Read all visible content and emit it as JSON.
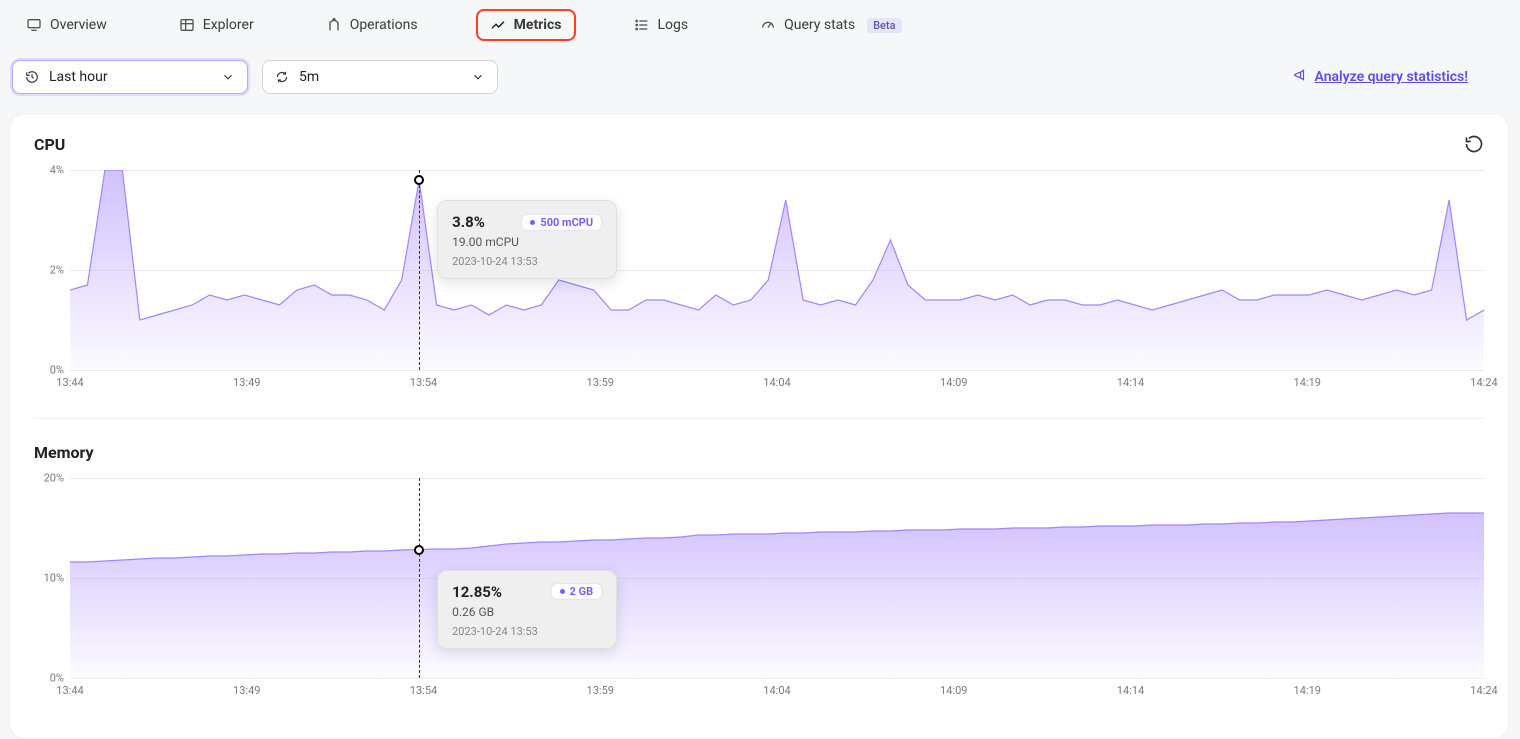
{
  "tabs": [
    {
      "key": "overview",
      "label": "Overview",
      "icon": "monitor-icon",
      "active": false
    },
    {
      "key": "explorer",
      "label": "Explorer",
      "icon": "table-icon",
      "active": false
    },
    {
      "key": "operations",
      "label": "Operations",
      "icon": "merge-icon",
      "active": false
    },
    {
      "key": "metrics",
      "label": "Metrics",
      "icon": "chart-icon",
      "active": true
    },
    {
      "key": "logs",
      "label": "Logs",
      "icon": "list-icon",
      "active": false
    },
    {
      "key": "querystats",
      "label": "Query stats",
      "icon": "gauge-icon",
      "active": false,
      "badge": "Beta"
    }
  ],
  "filters": {
    "range_label": "Last hour",
    "refresh_label": "5m"
  },
  "analyze_link": "Analyze query statistics!",
  "colors": {
    "accent": "#5b4ced",
    "area_fill": "#c9b6ff",
    "area_stroke": "#a384ff",
    "highlight": "#ff3d1f"
  },
  "chart_data": [
    {
      "id": "cpu",
      "type": "area",
      "title": "CPU",
      "ylabel": "%",
      "ylim": [
        0,
        4
      ],
      "y_ticks": [
        "0%",
        "2%",
        "4%"
      ],
      "x_ticks": [
        "13:44",
        "13:49",
        "13:54",
        "13:59",
        "14:04",
        "14:09",
        "14:14",
        "14:19",
        "14:24"
      ],
      "x_range_minutes": 42,
      "series": [
        {
          "name": "500 mCPU",
          "values_pct": [
            1.6,
            1.7,
            4.0,
            4.0,
            1.0,
            1.1,
            1.2,
            1.3,
            1.5,
            1.4,
            1.5,
            1.4,
            1.3,
            1.6,
            1.7,
            1.5,
            1.5,
            1.4,
            1.2,
            1.8,
            3.8,
            1.3,
            1.2,
            1.3,
            1.1,
            1.3,
            1.2,
            1.3,
            1.8,
            1.7,
            1.6,
            1.2,
            1.2,
            1.4,
            1.4,
            1.3,
            1.2,
            1.5,
            1.3,
            1.4,
            1.8,
            3.4,
            1.4,
            1.3,
            1.4,
            1.3,
            1.8,
            2.6,
            1.7,
            1.4,
            1.4,
            1.4,
            1.5,
            1.4,
            1.5,
            1.3,
            1.4,
            1.4,
            1.3,
            1.3,
            1.4,
            1.3,
            1.2,
            1.3,
            1.4,
            1.5,
            1.6,
            1.4,
            1.4,
            1.5,
            1.5,
            1.5,
            1.6,
            1.5,
            1.4,
            1.5,
            1.6,
            1.5,
            1.6,
            3.4,
            1.0,
            1.2
          ]
        }
      ],
      "tooltip": {
        "pct": "3.8%",
        "value": "19.00 mCPU",
        "chip": "500 mCPU",
        "timestamp": "2023-10-24 13:53",
        "hover_index": 20
      }
    },
    {
      "id": "memory",
      "type": "area",
      "title": "Memory",
      "ylabel": "%",
      "ylim": [
        0,
        20
      ],
      "y_ticks": [
        "0%",
        "10%",
        "20%"
      ],
      "x_ticks": [
        "13:44",
        "13:49",
        "13:54",
        "13:59",
        "14:04",
        "14:09",
        "14:14",
        "14:19",
        "14:24"
      ],
      "x_range_minutes": 42,
      "series": [
        {
          "name": "2 GB",
          "values_pct": [
            11.6,
            11.6,
            11.7,
            11.8,
            11.9,
            12.0,
            12.0,
            12.1,
            12.2,
            12.2,
            12.3,
            12.4,
            12.4,
            12.5,
            12.5,
            12.6,
            12.6,
            12.7,
            12.7,
            12.8,
            12.85,
            12.9,
            12.9,
            13.0,
            13.2,
            13.4,
            13.5,
            13.6,
            13.6,
            13.7,
            13.8,
            13.8,
            13.9,
            14.0,
            14.0,
            14.1,
            14.3,
            14.3,
            14.4,
            14.4,
            14.4,
            14.5,
            14.5,
            14.6,
            14.6,
            14.6,
            14.7,
            14.7,
            14.8,
            14.8,
            14.8,
            14.9,
            14.9,
            14.9,
            15.0,
            15.0,
            15.0,
            15.1,
            15.1,
            15.2,
            15.2,
            15.2,
            15.3,
            15.3,
            15.3,
            15.4,
            15.4,
            15.5,
            15.5,
            15.6,
            15.6,
            15.7,
            15.8,
            15.9,
            16.0,
            16.1,
            16.2,
            16.3,
            16.4,
            16.5,
            16.5,
            16.5
          ]
        }
      ],
      "tooltip": {
        "pct": "12.85%",
        "value": "0.26 GB",
        "chip": "2 GB",
        "timestamp": "2023-10-24 13:53",
        "hover_index": 20
      }
    }
  ]
}
